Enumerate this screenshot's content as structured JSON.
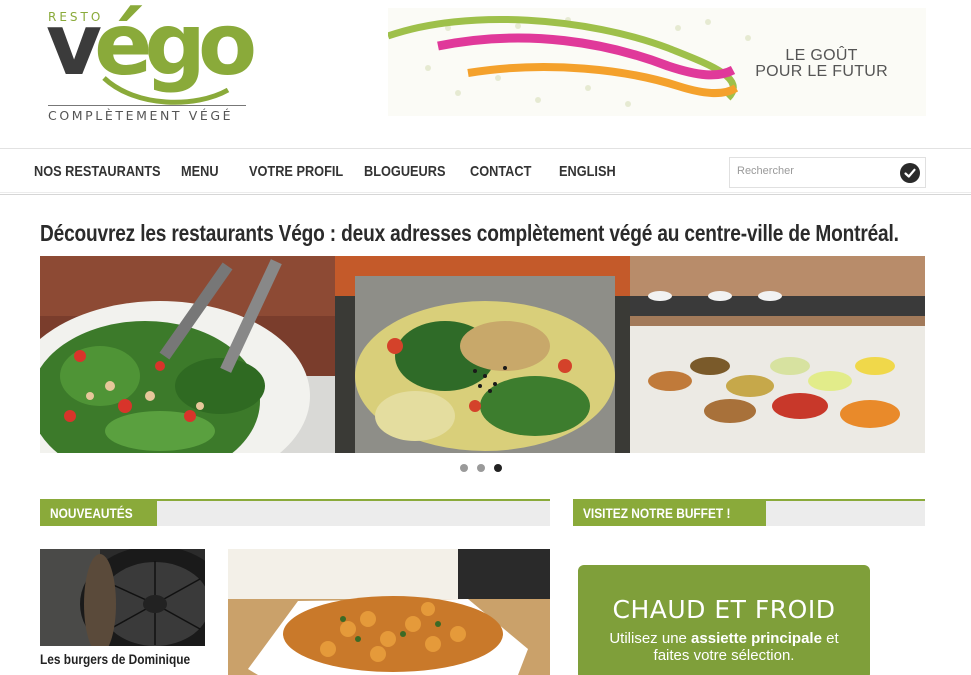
{
  "logo": {
    "resto": "RESTO",
    "vego_dark": "v",
    "vego_dark2": "é",
    "vego_green": "go",
    "tagline": "COMPLÈTEMENT VÉGÉ"
  },
  "banner": {
    "line1": "LE GOÛT",
    "line2": "POUR LE FUTUR"
  },
  "nav": {
    "items": [
      "NOS RESTAURANTS",
      "MENU",
      "VOTRE PROFIL",
      "BLOGUEURS",
      "CONTACT",
      "ENGLISH"
    ]
  },
  "search": {
    "placeholder": "Rechercher",
    "button_icon": "check-circle-icon"
  },
  "headline": "Découvrez les restaurants Végo : deux adresses complètement végé au centre-ville de Montréal.",
  "slider": {
    "images": [
      "spinach-salad-photo",
      "sesame-salad-photo",
      "buffet-bar-photo"
    ],
    "dots": 3,
    "active_dot": 3
  },
  "sections": {
    "news_label": "NOUVEAUTÉS",
    "buffet_label": "VISITEZ NOTRE BUFFET !"
  },
  "news": [
    {
      "title": "Les burgers de Dominique",
      "image": "portobello-mushroom-photo"
    },
    {
      "title": "",
      "image": "chickpea-salad-photo"
    }
  ],
  "buffet_card": {
    "title": "CHAUD ET FROID",
    "desc_pre": "Utilisez une ",
    "desc_bold": "assiette principale",
    "desc_post": " et",
    "desc_line2": "faites votre sélection."
  },
  "colors": {
    "brand_green": "#8aaa3a",
    "card_green": "#7f9f3a",
    "dark": "#3b3b3b"
  }
}
